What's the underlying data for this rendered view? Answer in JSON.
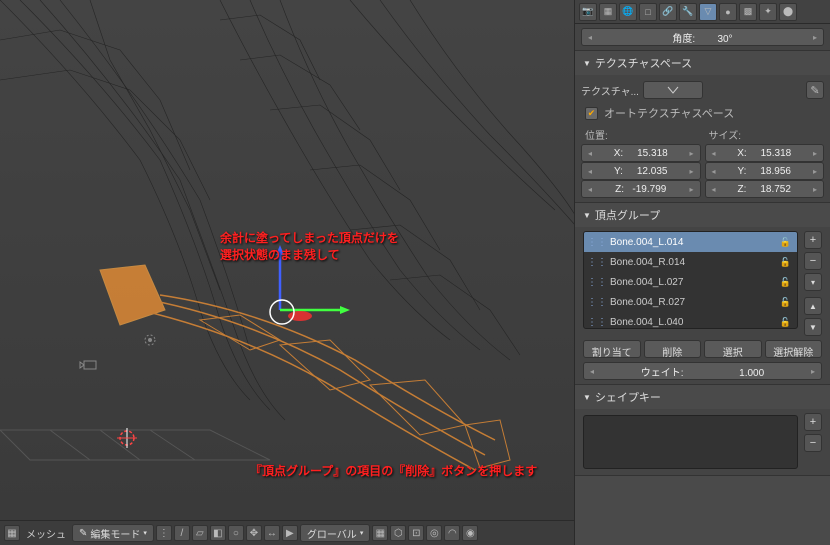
{
  "viewport": {
    "annotation1_line1": "余計に塗ってしまった頂点だけを",
    "annotation1_line2": "選択状態のまま残して",
    "annotation2": "『頂点グループ』の項目の『削除』ボタンを押します"
  },
  "footer": {
    "mesh_label": "メッシュ",
    "mode_label": "編集モード",
    "orientation_label": "グローバル"
  },
  "header": {
    "angle_label": "角度:",
    "angle_value": "30°"
  },
  "panels": {
    "texspace": {
      "title": "テクスチャスペース",
      "tex_label": "テクスチャ...",
      "auto_label": "オートテクスチャスペース",
      "pos_label": "位置:",
      "size_label": "サイズ:",
      "x": "X:",
      "y": "Y:",
      "z": "Z:",
      "pos_x": "15.318",
      "pos_y": "12.035",
      "pos_z": "-19.799",
      "size_x": "15.318",
      "size_y": "18.956",
      "size_z": "18.752"
    },
    "vgroups": {
      "title": "頂点グループ",
      "items": [
        "Bone.004_L.014",
        "Bone.004_R.014",
        "Bone.004_L.027",
        "Bone.004_R.027",
        "Bone.004_L.040"
      ],
      "assign": "割り当て",
      "remove": "削除",
      "select": "選択",
      "deselect": "選択解除",
      "weight_label": "ウェイト:",
      "weight_value": "1.000"
    },
    "shapekeys": {
      "title": "シェイプキー"
    }
  }
}
